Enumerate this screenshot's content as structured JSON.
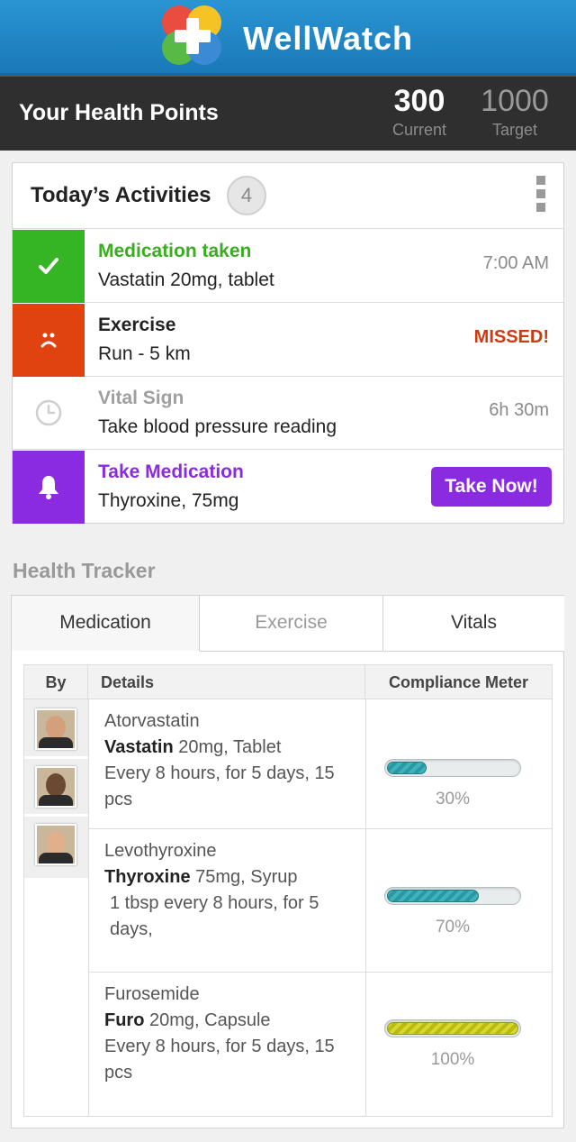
{
  "app": {
    "title": "WellWatch"
  },
  "points": {
    "label": "Your Health Points",
    "current": "300",
    "current_caption": "Current",
    "target": "1000",
    "target_caption": "Target"
  },
  "activities": {
    "title": "Today’s Activities",
    "count": "4",
    "items": [
      {
        "name": "Medication taken",
        "desc": "Vastatin 20mg, tablet",
        "status": "7:00 AM",
        "icon": "check-icon",
        "color": "#35b523"
      },
      {
        "name": "Exercise",
        "desc": "Run - 5 km",
        "status": "MISSED!",
        "icon": "sad-face-icon",
        "color": "#e04310"
      },
      {
        "name": "Vital Sign",
        "desc": "Take blood pressure reading",
        "status": "6h 30m",
        "icon": "clock-icon",
        "color": "#ffffff"
      },
      {
        "name": "Take Medication",
        "desc": "Thyroxine, 75mg",
        "action": "Take Now!",
        "icon": "bell-icon",
        "color": "#8a2be2"
      }
    ]
  },
  "tracker": {
    "title": "Health Tracker",
    "tabs": [
      "Medication",
      "Exercise",
      "Vitals"
    ],
    "active_tab": "Medication",
    "columns": {
      "by": "By",
      "details": "Details",
      "compliance": "Compliance Meter"
    },
    "rows": [
      {
        "generic": "Atorvastatin",
        "brand": "Vastatin",
        "dose": " 20mg, Tablet",
        "schedule": "Every 8 hours, for 5 days, 15 pcs",
        "compliance": 30,
        "compliance_label": "30%"
      },
      {
        "generic": "Levothyroxine",
        "brand": "Thyroxine",
        "dose": " 75mg, Syrup",
        "schedule": "1 tbsp every 8 hours, for 5 days,",
        "compliance": 70,
        "compliance_label": "70%"
      },
      {
        "generic": "Furosemide",
        "brand": "Furo",
        "dose": " 20mg, Capsule",
        "schedule": "Every 8 hours, for 5 days, 15 pcs",
        "compliance": 100,
        "compliance_label": "100%"
      }
    ]
  }
}
